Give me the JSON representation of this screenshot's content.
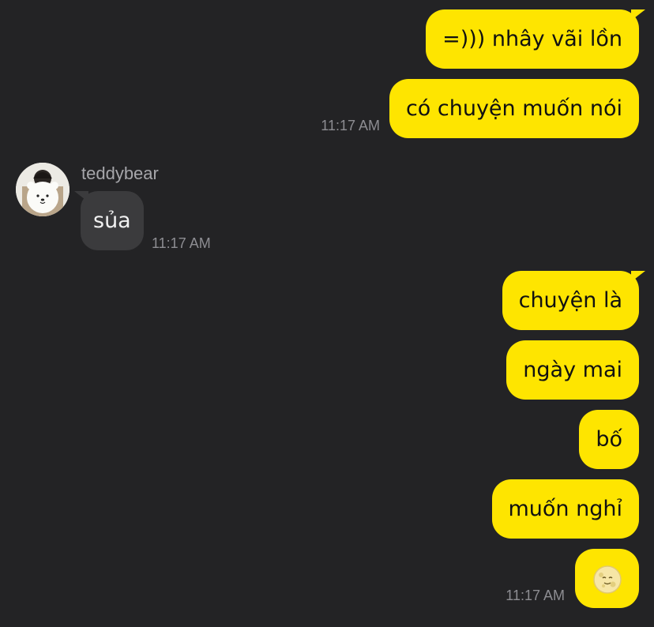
{
  "conversation": {
    "incoming": {
      "sender_name": "teddybear",
      "message": "sủa",
      "time": "11:17 AM"
    },
    "outgoing_group_1": {
      "messages": [
        "=))) nhây vãi lồn",
        "có chuyện muốn nói"
      ],
      "time": "11:17 AM"
    },
    "outgoing_group_2": {
      "messages": [
        "chuyện là",
        "ngày mai",
        "bố",
        "muốn nghỉ"
      ],
      "emoji": "moon-face-icon",
      "time": "11:17 AM"
    }
  },
  "colors": {
    "background": "#232325",
    "outgoing_bubble": "#FEE500",
    "incoming_bubble": "#3B3B3D",
    "timestamp": "#8D8D92"
  }
}
